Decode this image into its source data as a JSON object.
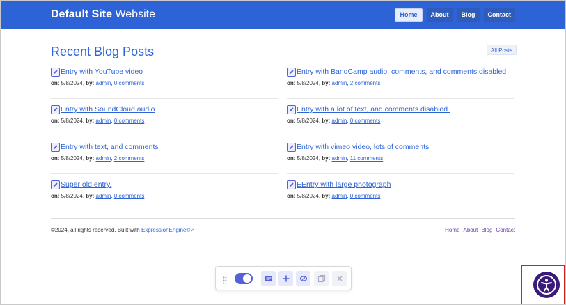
{
  "header": {
    "site_name_bold": "Default Site",
    "site_name_rest": " Website",
    "nav": [
      "Home",
      "About",
      "Blog",
      "Contact"
    ],
    "active_nav": "Home"
  },
  "main": {
    "title": "Recent Blog Posts",
    "all_posts_label": "All Posts",
    "on_label": "on:",
    "by_label": "by:",
    "posts": [
      {
        "title": "Entry with YouTube video",
        "date": "5/8/2024,",
        "author": "admin",
        "comments": "0 comments"
      },
      {
        "title": "Entry with BandCamp audio, comments, and comments disabled",
        "date": "5/8/2024,",
        "author": "admin",
        "comments": "2 comments"
      },
      {
        "title": "Entry with SoundCloud audio",
        "date": "5/8/2024,",
        "author": "admin",
        "comments": "0 comments"
      },
      {
        "title": "Entry with a lot of text, and comments disabled.",
        "date": "5/8/2024,",
        "author": "admin",
        "comments": "0 comments"
      },
      {
        "title": "Entry with text, and comments",
        "date": "5/8/2024,",
        "author": "admin",
        "comments": "2 comments"
      },
      {
        "title": "Entry with vimeo video, lots of comments",
        "date": "5/8/2024,",
        "author": "admin",
        "comments": "11 comments"
      },
      {
        "title": "Super old entry.",
        "date": "5/8/2024,",
        "author": "admin",
        "comments": "0 comments"
      },
      {
        "title": "EEntry with large photograph",
        "date": "5/8/2024,",
        "author": "admin",
        "comments": "0 comments"
      }
    ]
  },
  "footer": {
    "copyright": "©2024, all rights reserved. Built with ",
    "engine_link": "ExpressionEngine®",
    "links": [
      "Home",
      "About",
      "Blog",
      "Contact"
    ]
  },
  "toolbar": {
    "toggle_on": true,
    "buttons": [
      "form-icon",
      "plus-icon",
      "link-icon",
      "copy-icon",
      "close-icon"
    ]
  },
  "colors": {
    "brand": "#2d63d6",
    "accent": "#5561d6",
    "a11y": "#3a1a7a"
  }
}
